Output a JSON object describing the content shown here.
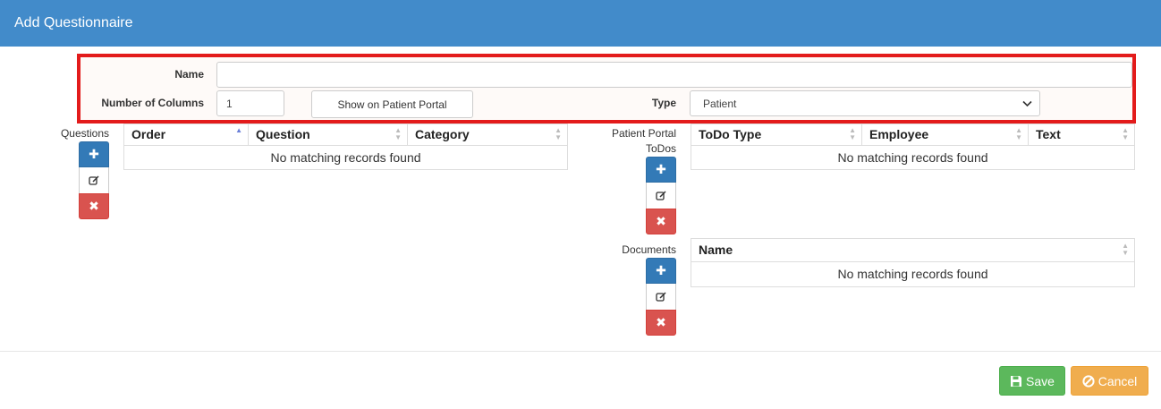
{
  "header": {
    "title": "Add Questionnaire"
  },
  "form": {
    "name_label": "Name",
    "name_value": "",
    "columns_label": "Number of Columns",
    "columns_value": "1",
    "portal_button": "Show on Patient Portal",
    "type_label": "Type",
    "type_value": "Patient"
  },
  "questions": {
    "label": "Questions",
    "columns": [
      "Order",
      "Question",
      "Category"
    ],
    "empty": "No matching records found"
  },
  "todos": {
    "label_line1": "Patient Portal",
    "label_line2": "ToDos",
    "columns": [
      "ToDo Type",
      "Employee",
      "Text"
    ],
    "empty": "No matching records found"
  },
  "documents": {
    "label": "Documents",
    "columns": [
      "Name"
    ],
    "empty": "No matching records found"
  },
  "buttons": {
    "add_glyph": "✚",
    "delete_glyph": "✖",
    "save": "Save",
    "cancel": "Cancel"
  },
  "icons": {
    "add": "plus-icon",
    "edit": "edit-icon",
    "delete": "times-icon",
    "save": "floppy-icon",
    "cancel": "ban-icon"
  },
  "colors": {
    "header": "#428bca",
    "highlight_border": "#e31b1b",
    "add": "#337ab7",
    "delete": "#d9534f",
    "save": "#5cb85c",
    "cancel": "#f0ad4e"
  }
}
